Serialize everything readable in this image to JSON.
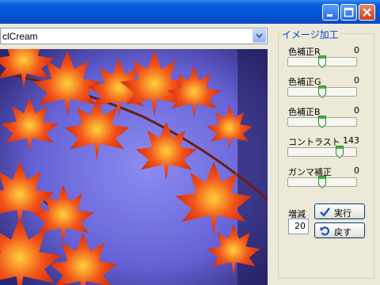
{
  "combo": {
    "value": "clCream"
  },
  "panel": {
    "group_title": "イメージ加工",
    "sliders": [
      {
        "label": "色補正R",
        "value": "0",
        "level": 0.5
      },
      {
        "label": "色補正G",
        "value": "0",
        "level": 0.5
      },
      {
        "label": "色補正B",
        "value": "0",
        "level": 0.5
      },
      {
        "label": "コントラスト",
        "value": "143",
        "level": 0.78
      },
      {
        "label": "ガンマ補正",
        "value": "0",
        "level": 0.5
      }
    ],
    "step_label": "増減",
    "step_value": "20",
    "run_button": "実行",
    "undo_button": "戻す"
  },
  "icons": [
    "minimize-icon",
    "maximize-icon",
    "close-icon",
    "chevron-down-icon",
    "checkmark-icon",
    "undo-icon"
  ],
  "colors": {
    "titlebar": "#0553d6",
    "legend": "#0046d5",
    "photo_background": "#6a68d8",
    "leaves": "#e8380e"
  }
}
